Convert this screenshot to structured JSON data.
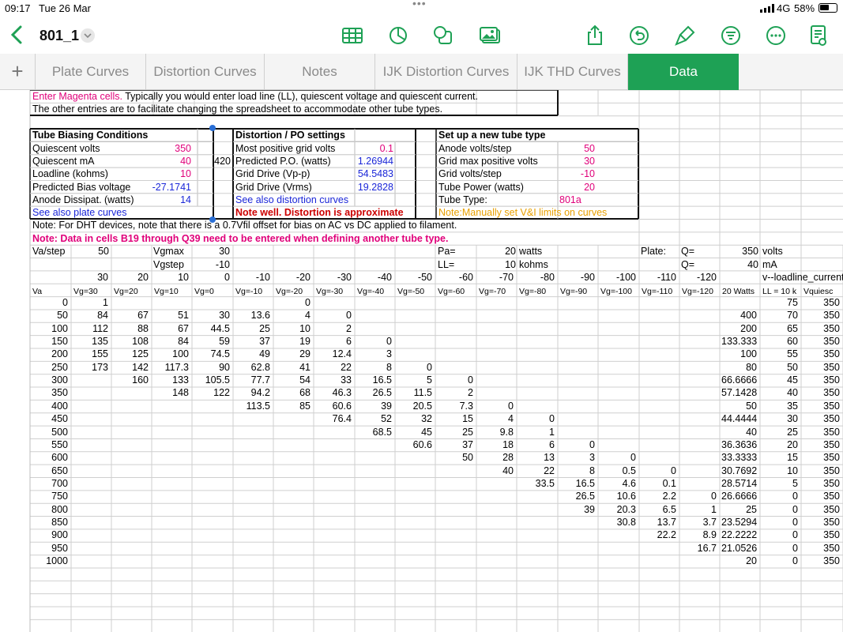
{
  "status": {
    "time": "09:17",
    "date": "Tue 26 Mar",
    "network": "4G",
    "battery": "58%"
  },
  "toolbar": {
    "title": "801_1",
    "icons": [
      "table-icon",
      "chart-icon",
      "shapes-icon",
      "media-icon",
      "share-icon",
      "undo-icon",
      "format-brush-icon",
      "organize-icon",
      "more-icon",
      "document-icon"
    ]
  },
  "tabs": [
    "Plate Curves",
    "Distortion Curves",
    "Notes",
    "IJK Distortion Curves",
    "IJK THD Curves",
    "Data"
  ],
  "sheet": {
    "intro": {
      "magenta": "Enter Magenta cells.",
      "rest": " Typically you would enter load line (LL), quiescent voltage and quiescent current.",
      "line2": "The other entries are to facilitate changing the spreadsheet to accommodate other tube types."
    },
    "bias": {
      "title": "Tube Biasing Conditions",
      "rows": [
        [
          "Quiescent volts",
          "350"
        ],
        [
          "Quiescent mA",
          "40"
        ],
        [
          "Loadline (kohms)",
          "10"
        ],
        [
          "Predicted Bias voltage",
          "-27.1741"
        ],
        [
          "Anode Dissipat. (watts)",
          "14"
        ]
      ],
      "link": "See also plate curves",
      "extra": "420"
    },
    "dist": {
      "title": "Distortion / PO settings",
      "rows": [
        [
          "Most positive grid volts",
          "0.1"
        ],
        [
          "Predicted P.O. (watts)",
          "1.26944"
        ],
        [
          "Grid Drive (Vp-p)",
          "54.5483"
        ],
        [
          "Grid Drive (Vrms)",
          "19.2828"
        ]
      ],
      "link": "See also distortion curves",
      "warn": "Note well. Distortion is approximate"
    },
    "newtube": {
      "title": "Set up a new tube type",
      "rows": [
        [
          "Anode volts/step",
          "50"
        ],
        [
          "Grid max positive volts",
          "30"
        ],
        [
          "Grid volts/step",
          "-10"
        ],
        [
          "Tube Power (watts)",
          "20"
        ],
        [
          "Tube Type:",
          "801a"
        ]
      ],
      "note": "Note:Manually set V&I limits on curves"
    },
    "note1": "Note: For DHT devices, note that there is a 0.7Vfil offset for bias on AC vs DC applied to filament.",
    "note2": "Note: Data in cells B19 through Q39 need to be entered when defining another tube type.",
    "params": {
      "va_step": "Va/step",
      "va_step_val": "50",
      "vgmax": "Vgmax",
      "vgmax_val": "30",
      "vgstep": "Vgstep",
      "vgstep_val": "-10",
      "pa": "Pa=",
      "pa_val": "20",
      "pa_unit": "watts",
      "ll": "LL=",
      "ll_val": "10",
      "ll_unit": "kohms",
      "plate": "Plate:",
      "q1": "Q=",
      "q1_val": "350",
      "q1_unit": "volts",
      "q2": "Q=",
      "q2_val": "40",
      "q2_unit": "mA",
      "loadline": "v--loadline_current"
    },
    "vg_values": [
      "30",
      "20",
      "10",
      "0",
      "-10",
      "-20",
      "-30",
      "-40",
      "-50",
      "-60",
      "-70",
      "-80",
      "-90",
      "-100",
      "-110",
      "-120"
    ],
    "headers": [
      "Va",
      "Vg=30",
      "Vg=20",
      "Vg=10",
      "Vg=0",
      "Vg=-10",
      "Vg=-20",
      "Vg=-30",
      "Vg=-40",
      "Vg=-50",
      "Vg=-60",
      "Vg=-70",
      "Vg=-80",
      "Vg=-90",
      "Vg=-100",
      "Vg=-110",
      "Vg=-120",
      "20 Watts",
      "LL = 10 k",
      "Vquiesc"
    ],
    "rows": [
      [
        "0",
        "1",
        "",
        "",
        "",
        "",
        "0",
        "",
        "",
        "",
        "",
        "",
        "",
        "",
        "",
        "",
        "",
        "",
        "75",
        "350"
      ],
      [
        "50",
        "84",
        "67",
        "51",
        "30",
        "13.6",
        "4",
        "0",
        "",
        "",
        "",
        "",
        "",
        "",
        "",
        "",
        "",
        "400",
        "70",
        "350"
      ],
      [
        "100",
        "112",
        "88",
        "67",
        "44.5",
        "25",
        "10",
        "2",
        "",
        "",
        "",
        "",
        "",
        "",
        "",
        "",
        "",
        "200",
        "65",
        "350"
      ],
      [
        "150",
        "135",
        "108",
        "84",
        "59",
        "37",
        "19",
        "6",
        "0",
        "",
        "",
        "",
        "",
        "",
        "",
        "",
        "",
        "133.333",
        "60",
        "350"
      ],
      [
        "200",
        "155",
        "125",
        "100",
        "74.5",
        "49",
        "29",
        "12.4",
        "3",
        "",
        "",
        "",
        "",
        "",
        "",
        "",
        "",
        "100",
        "55",
        "350"
      ],
      [
        "250",
        "173",
        "142",
        "117.3",
        "90",
        "62.8",
        "41",
        "22",
        "8",
        "0",
        "",
        "",
        "",
        "",
        "",
        "",
        "",
        "80",
        "50",
        "350"
      ],
      [
        "300",
        "",
        "160",
        "133",
        "105.5",
        "77.7",
        "54",
        "33",
        "16.5",
        "5",
        "0",
        "",
        "",
        "",
        "",
        "",
        "",
        "66.6666",
        "45",
        "350"
      ],
      [
        "350",
        "",
        "",
        "148",
        "122",
        "94.2",
        "68",
        "46.3",
        "26.5",
        "11.5",
        "2",
        "",
        "",
        "",
        "",
        "",
        "",
        "57.1428",
        "40",
        "350"
      ],
      [
        "400",
        "",
        "",
        "",
        "",
        "113.5",
        "85",
        "60.6",
        "39",
        "20.5",
        "7.3",
        "0",
        "",
        "",
        "",
        "",
        "",
        "50",
        "35",
        "350"
      ],
      [
        "450",
        "",
        "",
        "",
        "",
        "",
        "",
        "76.4",
        "52",
        "32",
        "15",
        "4",
        "0",
        "",
        "",
        "",
        "",
        "44.4444",
        "30",
        "350"
      ],
      [
        "500",
        "",
        "",
        "",
        "",
        "",
        "",
        "",
        "68.5",
        "45",
        "25",
        "9.8",
        "1",
        "",
        "",
        "",
        "",
        "40",
        "25",
        "350"
      ],
      [
        "550",
        "",
        "",
        "",
        "",
        "",
        "",
        "",
        "",
        "60.6",
        "37",
        "18",
        "6",
        "0",
        "",
        "",
        "",
        "36.3636",
        "20",
        "350"
      ],
      [
        "600",
        "",
        "",
        "",
        "",
        "",
        "",
        "",
        "",
        "",
        "50",
        "28",
        "13",
        "3",
        "0",
        "",
        "",
        "33.3333",
        "15",
        "350"
      ],
      [
        "650",
        "",
        "",
        "",
        "",
        "",
        "",
        "",
        "",
        "",
        "",
        "40",
        "22",
        "8",
        "0.5",
        "0",
        "",
        "30.7692",
        "10",
        "350"
      ],
      [
        "700",
        "",
        "",
        "",
        "",
        "",
        "",
        "",
        "",
        "",
        "",
        "",
        "33.5",
        "16.5",
        "4.6",
        "0.1",
        "",
        "28.5714",
        "5",
        "350"
      ],
      [
        "750",
        "",
        "",
        "",
        "",
        "",
        "",
        "",
        "",
        "",
        "",
        "",
        "",
        "26.5",
        "10.6",
        "2.2",
        "0",
        "26.6666",
        "0",
        "350"
      ],
      [
        "800",
        "",
        "",
        "",
        "",
        "",
        "",
        "",
        "",
        "",
        "",
        "",
        "",
        "39",
        "20.3",
        "6.5",
        "1",
        "25",
        "0",
        "350"
      ],
      [
        "850",
        "",
        "",
        "",
        "",
        "",
        "",
        "",
        "",
        "",
        "",
        "",
        "",
        "",
        "30.8",
        "13.7",
        "3.7",
        "23.5294",
        "0",
        "350"
      ],
      [
        "900",
        "",
        "",
        "",
        "",
        "",
        "",
        "",
        "",
        "",
        "",
        "",
        "",
        "",
        "",
        "22.2",
        "8.9",
        "22.2222",
        "0",
        "350"
      ],
      [
        "950",
        "",
        "",
        "",
        "",
        "",
        "",
        "",
        "",
        "",
        "",
        "",
        "",
        "",
        "",
        "",
        "16.7",
        "21.0526",
        "0",
        "350"
      ],
      [
        "1000",
        "",
        "",
        "",
        "",
        "",
        "",
        "",
        "",
        "",
        "",
        "",
        "",
        "",
        "",
        "",
        "",
        "20",
        "0",
        "350"
      ]
    ]
  }
}
